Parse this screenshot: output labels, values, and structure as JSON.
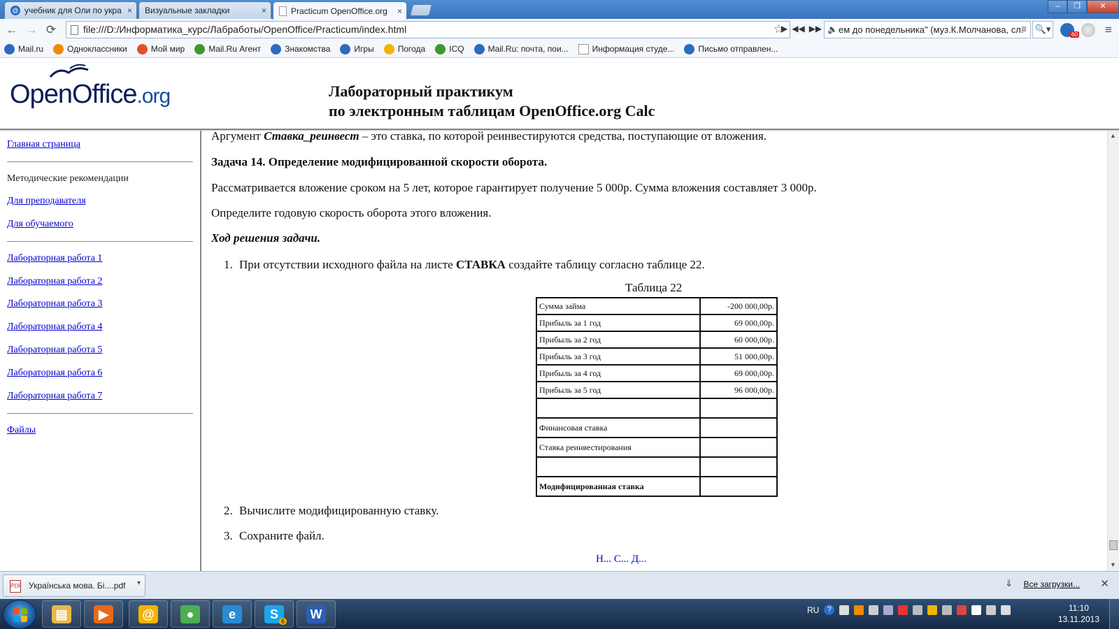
{
  "browser": {
    "tabs": [
      {
        "title": "учебник для Оли по укра"
      },
      {
        "title": "Визуальные закладки"
      },
      {
        "title": "Practicum OpenOffice.org"
      }
    ],
    "tab_close": "×",
    "window_controls": {
      "minimize": "–",
      "maximize": "❐",
      "close": "✕"
    },
    "nav": {
      "back": "←",
      "forward": "→",
      "reload": "⟳"
    },
    "url": "file:///D:/Информатика_курс/Лабработы/OpenOffice/Practicum/index.html",
    "star": "☆",
    "player": {
      "play": "▶",
      "prev": "◀◀",
      "next": "▶▶"
    },
    "now_playing": "ем до понедельника\" (муз.К.Молчанова, сл.",
    "now_playing_icon": "🔈",
    "now_playing_menu": "≡",
    "search_mini": "🔍▾",
    "mail_badge": "60",
    "wrench": "≡"
  },
  "bookmarks": [
    {
      "label": "Mail.ru",
      "color": "#2b6bc0"
    },
    {
      "label": "Одноклассники",
      "color": "#f08a00"
    },
    {
      "label": "Мой мир",
      "color": "#e0502a"
    },
    {
      "label": "Mail.Ru Агент",
      "color": "#3a9a2a"
    },
    {
      "label": "Знакомства",
      "color": "#2b6bc0"
    },
    {
      "label": "Игры",
      "color": "#2b6bc0"
    },
    {
      "label": "Погода",
      "color": "#f2b400"
    },
    {
      "label": "ICQ",
      "color": "#3a9a2a"
    },
    {
      "label": "Mail.Ru: почта, пои...",
      "color": "#2b6bc0"
    },
    {
      "label": "Информация студе...",
      "color": "#cccccc"
    },
    {
      "label": "Письмо отправлен...",
      "color": "#2b6bc0"
    }
  ],
  "header": {
    "logo": "OpenOffice",
    "logo_suffix": ".org",
    "title_line1": "Лабораторный практикум",
    "title_line2": "по электронным таблицам OpenOffice.org Calc"
  },
  "sidebar": {
    "home": "Главная страница",
    "methods": "Методические рекомендации",
    "teacher": "Для преподавателя",
    "student": "Для обучаемого",
    "labs": [
      "Лабораторная работа 1",
      "Лабораторная работа 2",
      "Лабораторная работа 3",
      "Лабораторная работа 4",
      "Лабораторная работа 5",
      "Лабораторная работа 6",
      "Лабораторная работа 7"
    ],
    "files": "Файлы"
  },
  "content": {
    "arg_prefix": "Аргумент ",
    "arg_name": "Ставка_реинвест",
    "arg_text": " – это ставка, по которой реинвестируются средства, поступающие от вложения.",
    "task_title": "Задача 14. Определение модифицированной скорости оборота.",
    "para1": "Рассматривается вложение сроком на 5 лет, которое гарантирует получение 5 000р. Сумма вложения составляет 3 000р.",
    "para2": "Определите годовую скорость оборота этого вложения.",
    "solution": "Ход решения задачи.",
    "step1_num": "1.",
    "step1_a": "При отсутствии исходного файла на листе ",
    "step1_b": "СТАВКА",
    "step1_c": " создайте таблицу согласно таблице 22.",
    "table_caption": "Таблица 22",
    "table_rows": [
      {
        "label": "Сумма займа",
        "value": "-200 000,00р."
      },
      {
        "label": "Прибыль за 1 год",
        "value": "69 000,00р."
      },
      {
        "label": "Прибыль за 2 год",
        "value": "60 000,00р."
      },
      {
        "label": "Прибыль за 3 год",
        "value": "51 000,00р."
      },
      {
        "label": "Прибыль за 4 год",
        "value": "69 000,00р."
      },
      {
        "label": "Прибыль за 5 год",
        "value": "96 000,00р."
      },
      {
        "label": "",
        "value": ""
      },
      {
        "label": "Финансовая ставка",
        "value": ""
      },
      {
        "label": "Ставка реинвестирования",
        "value": ""
      },
      {
        "label": "",
        "value": ""
      },
      {
        "label": "Модифицированная ставка",
        "value": ""
      }
    ],
    "step2_num": "2.",
    "step2": "Вычислите модифицированную ставку.",
    "step3_num": "3.",
    "step3": "Сохраните файл.",
    "bottom_nav": "Н...   С...   Д..."
  },
  "scrollbar": {
    "up": "▲",
    "down": "▼"
  },
  "downloads": {
    "file": "Українська мова. Бі....pdf",
    "file_icon": "PDF",
    "file_menu": "▾",
    "all_icon": "⇓",
    "all": "Все загрузки...",
    "close": "✕"
  },
  "taskbar": {
    "apps": [
      {
        "name": "explorer",
        "glyph": "▤",
        "color": "#e8b84a"
      },
      {
        "name": "media",
        "glyph": "▶",
        "color": "#e66a1a"
      },
      {
        "name": "mail-agent",
        "glyph": "@",
        "color": "#f2b400"
      },
      {
        "name": "chrome",
        "glyph": "●",
        "color": "#4caf50"
      },
      {
        "name": "ie",
        "glyph": "e",
        "color": "#2a8ad4"
      },
      {
        "name": "skype",
        "glyph": "S",
        "color": "#1aa7e8"
      },
      {
        "name": "word",
        "glyph": "W",
        "color": "#2b5fb3"
      }
    ],
    "skype_badge": "6",
    "lang": "RU",
    "help": "?",
    "time": "11:10",
    "date": "13.11.2013"
  }
}
